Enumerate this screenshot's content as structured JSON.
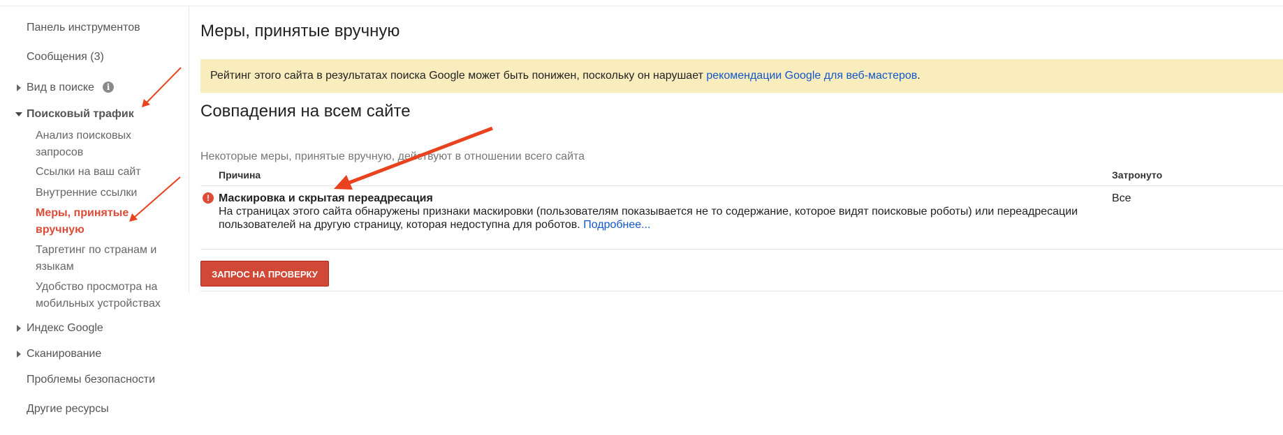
{
  "sidebar": {
    "dashboard": "Панель инструментов",
    "messages": "Сообщения (3)",
    "search_appearance": "Вид в поиске",
    "search_traffic": "Поисковый трафик",
    "search_traffic_items": [
      "Анализ поисковых запросов",
      "Ссылки на ваш сайт",
      "Внутренние ссылки",
      "Меры, принятые вручную",
      "Таргетинг по странам и языкам",
      "Удобство просмотра на мобильных устройствах"
    ],
    "google_index": "Индекс Google",
    "crawl": "Сканирование",
    "security_issues": "Проблемы безопасности",
    "other_resources": "Другие ресурсы"
  },
  "main": {
    "title": "Меры, принятые вручную",
    "banner_text": "Рейтинг этого сайта в результатах поиска Google может быть понижен, поскольку он нарушает ",
    "banner_link": "рекомендации Google для веб-мастеров",
    "banner_end": ".",
    "section_title": "Совпадения на всем сайте",
    "section_desc": "Некоторые меры, принятые вручную, действуют в отношении всего сайта",
    "col_reason": "Причина",
    "col_affected": "Затронуто",
    "issue_title": "Маскировка и скрытая переадресация",
    "issue_desc": "На страницах этого сайта обнаружены признаки маскировки (пользователям показывается не то содержание, которое видят поисковые роботы) или переадресации пользователей на другую страницу, которая недоступна для роботов. ",
    "issue_more": "Подробнее...",
    "issue_affected": "Все",
    "request_button": "ЗАПРОС НА ПРОВЕРКУ"
  },
  "colors": {
    "accent": "#dd4b39",
    "banner_bg": "#f9edbe",
    "link": "#1155cc",
    "annotation_arrow": "#e8421f"
  }
}
